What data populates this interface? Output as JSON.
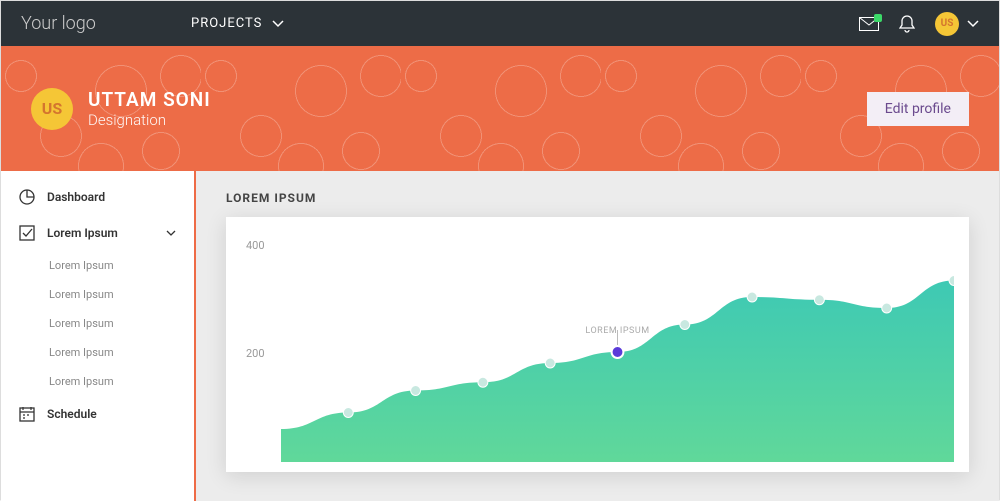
{
  "topbar": {
    "logo": "Your logo",
    "projects_label": "PROJECTS",
    "avatar_initials": "US"
  },
  "banner": {
    "avatar_initials": "US",
    "name": "UTTAM SONI",
    "designation": "Designation",
    "edit_label": "Edit profile"
  },
  "sidebar": {
    "dashboard": "Dashboard",
    "lorem": "Lorem Ipsum",
    "subs": [
      "Lorem Ipsum",
      "Lorem Ipsum",
      "Lorem Ipsum",
      "Lorem Ipsum",
      "Lorem Ipsum"
    ],
    "schedule": "Schedule"
  },
  "chart_title": "LOREM IPSUM",
  "chart_data": {
    "type": "area",
    "x": [
      0,
      1,
      2,
      3,
      4,
      5,
      6,
      7,
      8,
      9,
      10
    ],
    "values": [
      60,
      90,
      130,
      145,
      180,
      200,
      250,
      300,
      295,
      280,
      330
    ],
    "ylim": [
      0,
      400
    ],
    "ticks": [
      200,
      400
    ],
    "tooltip": {
      "index": 5,
      "label": "LOREM IPSUM"
    },
    "highlight_index": 5,
    "colors": {
      "fill_top": "#3ec9b4",
      "fill_bottom": "#60d89a",
      "point": "#c8e8e0",
      "highlight": "#5b3bd9"
    }
  }
}
